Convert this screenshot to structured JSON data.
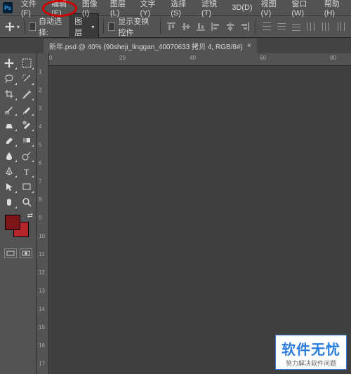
{
  "app": {
    "logo": "Ps"
  },
  "menu": {
    "file": "文件(F)",
    "edit": "编辑(E)",
    "image": "图像(I)",
    "layer": "图层(L)",
    "type": "文字(Y)",
    "select": "选择(S)",
    "filter": "滤镜(T)",
    "3d": "3D(D)",
    "view": "视图(V)",
    "window": "窗口(W)",
    "help": "帮助(H)"
  },
  "options": {
    "auto_select_label": "自动选择:",
    "target_dropdown": "图层",
    "show_transform_label": "显示变换控件"
  },
  "tab": {
    "title": "新年.psd @ 40% (90sheji_linggan_40070633 拷贝 4, RGB/8#)",
    "close": "×"
  },
  "ruler": {
    "h": [
      "0",
      "20",
      "40",
      "60",
      "80"
    ],
    "v": [
      "1",
      "2",
      "3",
      "4",
      "5",
      "6",
      "7",
      "8",
      "9",
      "10",
      "11",
      "12",
      "13",
      "14",
      "15",
      "16",
      "17"
    ]
  },
  "colors": {
    "foreground": "#7a1618",
    "background": "#b5252a"
  },
  "watermark": {
    "title": "软件无忧",
    "subtitle": "努力解决软件问题"
  }
}
